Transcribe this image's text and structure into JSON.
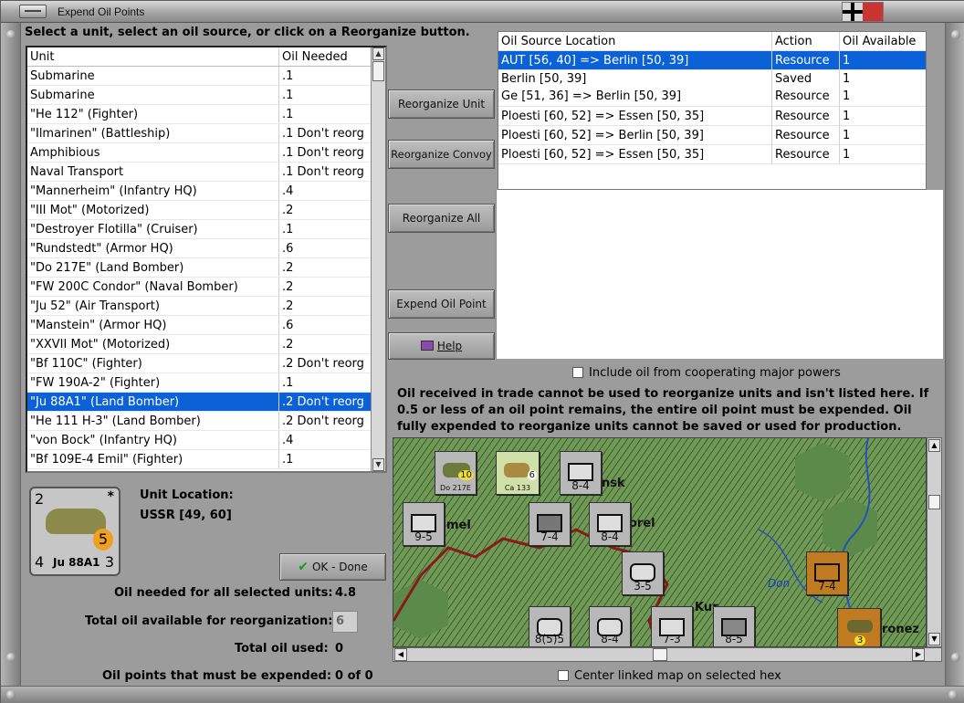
{
  "window": {
    "title": "Expend Oil Points"
  },
  "instruction": "Select a unit, select an oil source, or click on a Reorganize button.",
  "unit_list": {
    "headers": [
      "Unit",
      "Oil Needed"
    ],
    "rows": [
      {
        "unit": "Submarine",
        "oil": ".1"
      },
      {
        "unit": "Submarine",
        "oil": ".1"
      },
      {
        "unit": "\"He 112\" (Fighter)",
        "oil": ".1"
      },
      {
        "unit": "\"Ilmarinen\" (Battleship)",
        "oil": ".1 Don't reorg"
      },
      {
        "unit": "Amphibious",
        "oil": ".1 Don't reorg"
      },
      {
        "unit": "Naval Transport",
        "oil": ".1 Don't reorg"
      },
      {
        "unit": "\"Mannerheim\" (Infantry HQ)",
        "oil": ".4"
      },
      {
        "unit": "\"III Mot\" (Motorized)",
        "oil": ".2"
      },
      {
        "unit": "\"Destroyer Flotilla\" (Cruiser)",
        "oil": ".1"
      },
      {
        "unit": "\"Rundstedt\" (Armor HQ)",
        "oil": ".6"
      },
      {
        "unit": "\"Do 217E\" (Land Bomber)",
        "oil": ".2"
      },
      {
        "unit": "\"FW 200C Condor\" (Naval Bomber)",
        "oil": ".2"
      },
      {
        "unit": "\"Ju 52\" (Air Transport)",
        "oil": ".2"
      },
      {
        "unit": "\"Manstein\" (Armor HQ)",
        "oil": ".6"
      },
      {
        "unit": "\"XXVII Mot\" (Motorized)",
        "oil": ".2"
      },
      {
        "unit": "\"Bf 110C\" (Fighter)",
        "oil": ".2 Don't reorg"
      },
      {
        "unit": "\"FW 190A-2\" (Fighter)",
        "oil": ".1"
      },
      {
        "unit": "\"Ju 88A1\" (Land Bomber)",
        "oil": ".2 Don't reorg"
      },
      {
        "unit": "\"He 111 H-3\" (Land Bomber)",
        "oil": ".2 Don't reorg"
      },
      {
        "unit": "\"von Bock\" (Infantry HQ)",
        "oil": ".4"
      },
      {
        "unit": "\"Bf 109E-4 Emil\" (Fighter)",
        "oil": ".1"
      }
    ],
    "selected_index": 17
  },
  "buttons": {
    "reorganize_unit": "Reorganize Unit",
    "reorganize_convoy": "Reorganize Convoy",
    "reorganize_all": "Reorganize All",
    "expend_oil_point": "Expend Oil Point",
    "help": "Help",
    "ok_done": "OK - Done"
  },
  "source_table": {
    "headers": [
      "Oil Source Location",
      "Action",
      "Oil Available"
    ],
    "rows": [
      {
        "location": "AUT [56, 40] => Berlin [50, 39]",
        "action": "Resource",
        "oil": "1"
      },
      {
        "location": "Berlin [50, 39]",
        "location2": "Ge [51, 36] => Berlin [50, 39]",
        "action": "Saved",
        "action2": "Resource",
        "oil": "1",
        "oil2": "1"
      },
      {
        "location": "Ploesti [60, 52] => Essen [50, 35]",
        "action": "Resource",
        "oil": "1"
      },
      {
        "location": "Ploesti [60, 52] => Berlin [50, 39]",
        "action": "Resource",
        "oil": "1"
      },
      {
        "location": "Ploesti [60, 52] => Essen [50, 35]",
        "action": "Resource",
        "oil": "1"
      }
    ],
    "selected_index": 0
  },
  "include_cooperating": "Include oil from cooperating major powers",
  "note": "Oil received in trade cannot be used to reorganize units and isn't listed here.  If 0.5 or less of an oil point remains, the entire oil point must be expended.   Oil fully expended to reorganize units cannot be saved or used for production.",
  "unit_card": {
    "top_left": "2",
    "bottom_left": "4",
    "bottom_right": "3",
    "oil": "5",
    "name": "Ju 88A1",
    "star": "*"
  },
  "unit_location": {
    "label": "Unit Location:",
    "value": "USSR [49, 60]"
  },
  "stats": {
    "oil_needed_label": "Oil needed for all selected units:",
    "oil_needed_value": "4.8",
    "total_available_label": "Total oil available for reorganization:",
    "total_available_value": "6",
    "total_used_label": "Total oil used:",
    "total_used_value": "0",
    "must_expend_label": "Oil points that must be expended:",
    "must_expend_value": "0 of 0"
  },
  "center_map": "Center linked map on selected hex",
  "map": {
    "labels": [
      "mel",
      "orel",
      "nsk",
      "Don",
      "Kur",
      "ronez"
    ],
    "counters": [
      {
        "top": "3",
        "mid": "Do 217E",
        "right": "10",
        "bottom": "4"
      },
      {
        "top": "0",
        "mid": "Ca 133",
        "right": "6",
        "bottom": "1"
      },
      {
        "top": "2",
        "sym": "xxx",
        "bottom": "8-4"
      },
      {
        "top": "2",
        "sym": "xxx",
        "bottom": "9-5"
      },
      {
        "top": "2",
        "sym": "xxx",
        "bottom": "7-4"
      },
      {
        "top": "2",
        "sym": "xxx",
        "bottom": "8-4"
      },
      {
        "top": "3",
        "sym": "xx",
        "bottom": "3-5"
      },
      {
        "top": "R",
        "sym": "xxxx",
        "bottom": "7-4"
      },
      {
        "top": "2",
        "sym": "xxx",
        "bottom": "8(5)5"
      },
      {
        "top": "2",
        "sym": "xxx",
        "bottom": "8-4"
      },
      {
        "top": "3",
        "sym": "xxx",
        "bottom": "7-3"
      },
      {
        "top": "2",
        "sym": "xxx",
        "bottom": "8-5"
      },
      {
        "top": "3",
        "sym": "145bis",
        "bottom": "3"
      }
    ]
  },
  "colors": {
    "selection": "#0a62d6",
    "german_counter": "#b8b8b8",
    "soviet_counter": "#c07a1f",
    "map_green": "#5e8a48",
    "border_red": "#8a1a1a"
  }
}
